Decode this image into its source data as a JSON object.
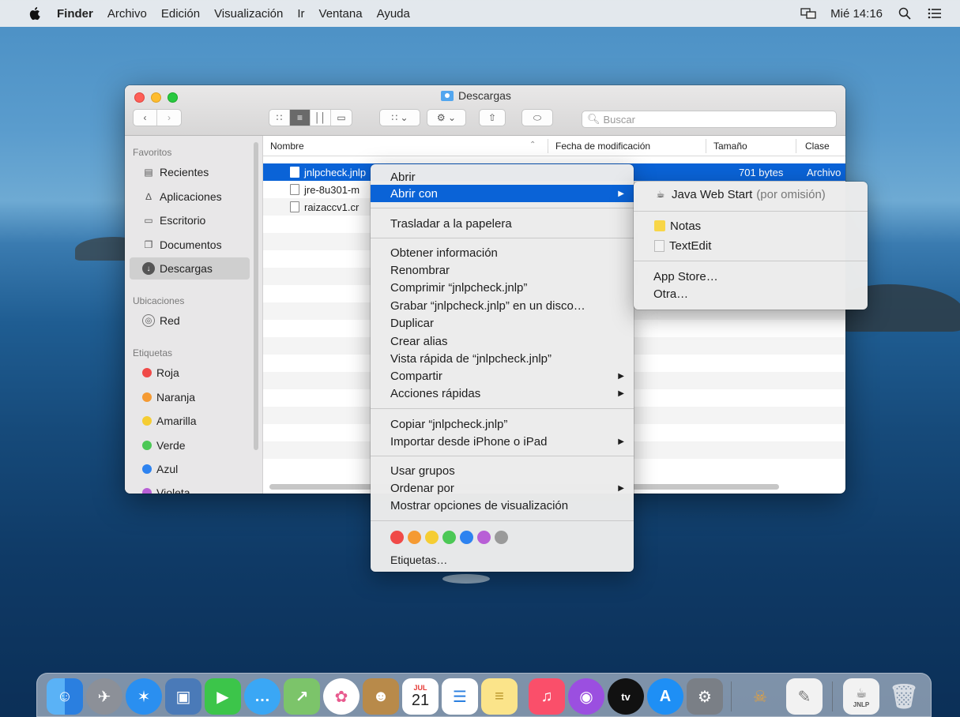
{
  "menubar": {
    "app": "Finder",
    "items": [
      "Archivo",
      "Edición",
      "Visualización",
      "Ir",
      "Ventana",
      "Ayuda"
    ],
    "clock": "Mié 14:16",
    "icons": [
      "apple-icon",
      "mirroring-icon",
      "search-icon",
      "control-list-icon"
    ]
  },
  "window": {
    "title": "Descargas",
    "search_placeholder": "Buscar",
    "sidebar": {
      "favoritos_label": "Favoritos",
      "favoritos": [
        "Recientes",
        "Aplicaciones",
        "Escritorio",
        "Documentos",
        "Descargas"
      ],
      "ubicaciones_label": "Ubicaciones",
      "ubicaciones": [
        "Red"
      ],
      "etiquetas_label": "Etiquetas",
      "etiquetas": [
        {
          "name": "Roja",
          "color": "#f04a48"
        },
        {
          "name": "Naranja",
          "color": "#f59a32"
        },
        {
          "name": "Amarilla",
          "color": "#f5cd33"
        },
        {
          "name": "Verde",
          "color": "#4cc856"
        },
        {
          "name": "Azul",
          "color": "#2e83f0"
        },
        {
          "name": "Violeta",
          "color": "#b85fd6"
        }
      ]
    },
    "columns": {
      "name": "Nombre",
      "date": "Fecha de modificación",
      "size": "Tamaño",
      "kind": "Clase"
    },
    "files": [
      {
        "name": "jnlpcheck.jnlp",
        "size": "701 bytes",
        "kind": "Archivo"
      },
      {
        "name": "jre-8u301-m",
        "size": "",
        "kind": ""
      },
      {
        "name": "raizaccv1.cr",
        "size": "",
        "kind": ""
      }
    ]
  },
  "context_menu": {
    "items": {
      "abrir": "Abrir",
      "abrir_con": "Abrir con",
      "trasladar": "Trasladar a la papelera",
      "obtener": "Obtener información",
      "renombrar": "Renombrar",
      "comprimir": "Comprimir “jnlpcheck.jnlp”",
      "grabar": "Grabar “jnlpcheck.jnlp” en un disco…",
      "duplicar": "Duplicar",
      "crear_alias": "Crear alias",
      "vista_rapida": "Vista rápida de “jnlpcheck.jnlp”",
      "compartir": "Compartir",
      "acciones": "Acciones rápidas",
      "copiar": "Copiar “jnlpcheck.jnlp”",
      "importar": "Importar desde iPhone o iPad",
      "usar_grupos": "Usar grupos",
      "ordenar": "Ordenar por",
      "mostrar_opciones": "Mostrar opciones de visualización",
      "etiquetas": "Etiquetas…"
    },
    "tag_colors": [
      "#f04a48",
      "#f59a32",
      "#f5cd33",
      "#4cc856",
      "#2e83f0",
      "#b85fd6",
      "#9a9a9a"
    ]
  },
  "submenu": {
    "java": "Java Web Start",
    "java_default": "(por omisión)",
    "notas": "Notas",
    "textedit": "TextEdit",
    "app_store": "App Store…",
    "otra": "Otra…"
  },
  "dock": {
    "calendar_month": "JUL",
    "calendar_day": "21",
    "apps": [
      "Finder",
      "Launchpad",
      "Safari",
      "Vista Previa",
      "FaceTime",
      "Mensajes",
      "Mapas",
      "Fotos",
      "Contactos",
      "Calendario",
      "Recordatorios",
      "Notas",
      "Música",
      "Podcasts",
      "TV",
      "App Store",
      "Preferencias del Sistema",
      "Acceso a Llaveros",
      "TextEdit",
      "JNLP",
      "Papelera"
    ],
    "tv_label": "tv",
    "jnlp_label": "JNLP"
  }
}
